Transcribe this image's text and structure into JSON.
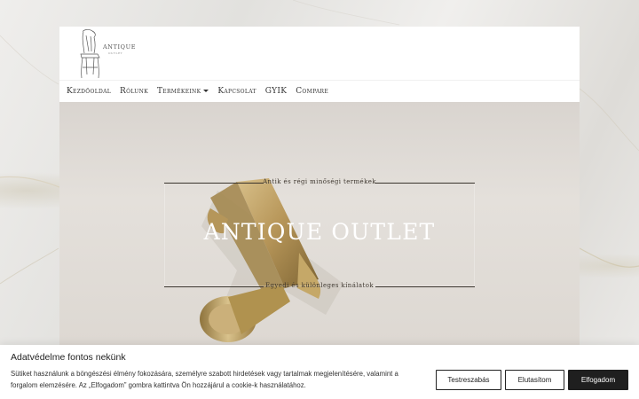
{
  "brand": {
    "logo_text": "ANTIQUE",
    "logo_sub": "OUTLET",
    "logo_icon": "antique-chair-icon"
  },
  "nav": {
    "items": [
      {
        "label": "Kezdőoldal"
      },
      {
        "label": "Rólunk"
      },
      {
        "label": "Termékeink"
      },
      {
        "label": "Kapcsolat"
      },
      {
        "label": "GYIK"
      },
      {
        "label": "Compare"
      }
    ],
    "dropdown_icon": "caret-down-icon"
  },
  "hero": {
    "tagline_top": "Antik és régi minőségi termékek",
    "title": "ANTIQUE OUTLET",
    "tagline_bottom": "Egyedi és különleges kínálatok"
  },
  "cookie_banner": {
    "title": "Adatvédelme fontos nekünk",
    "text": "Sütiket használunk a böngészési élmény fokozására, személyre szabott hirdetések vagy tartalmak megjelenítésére, valamint a forgalom elemzésére. Az „Elfogadom” gombra kattintva Ön hozzájárul a cookie-k használatához.",
    "customize_label": "Testreszabás",
    "reject_label": "Elutasítom",
    "accept_label": "Elfogadom"
  },
  "colors": {
    "accent_dark": "#1f1f1f",
    "hero_text": "#ffffff",
    "brass": "#b89a5a"
  }
}
